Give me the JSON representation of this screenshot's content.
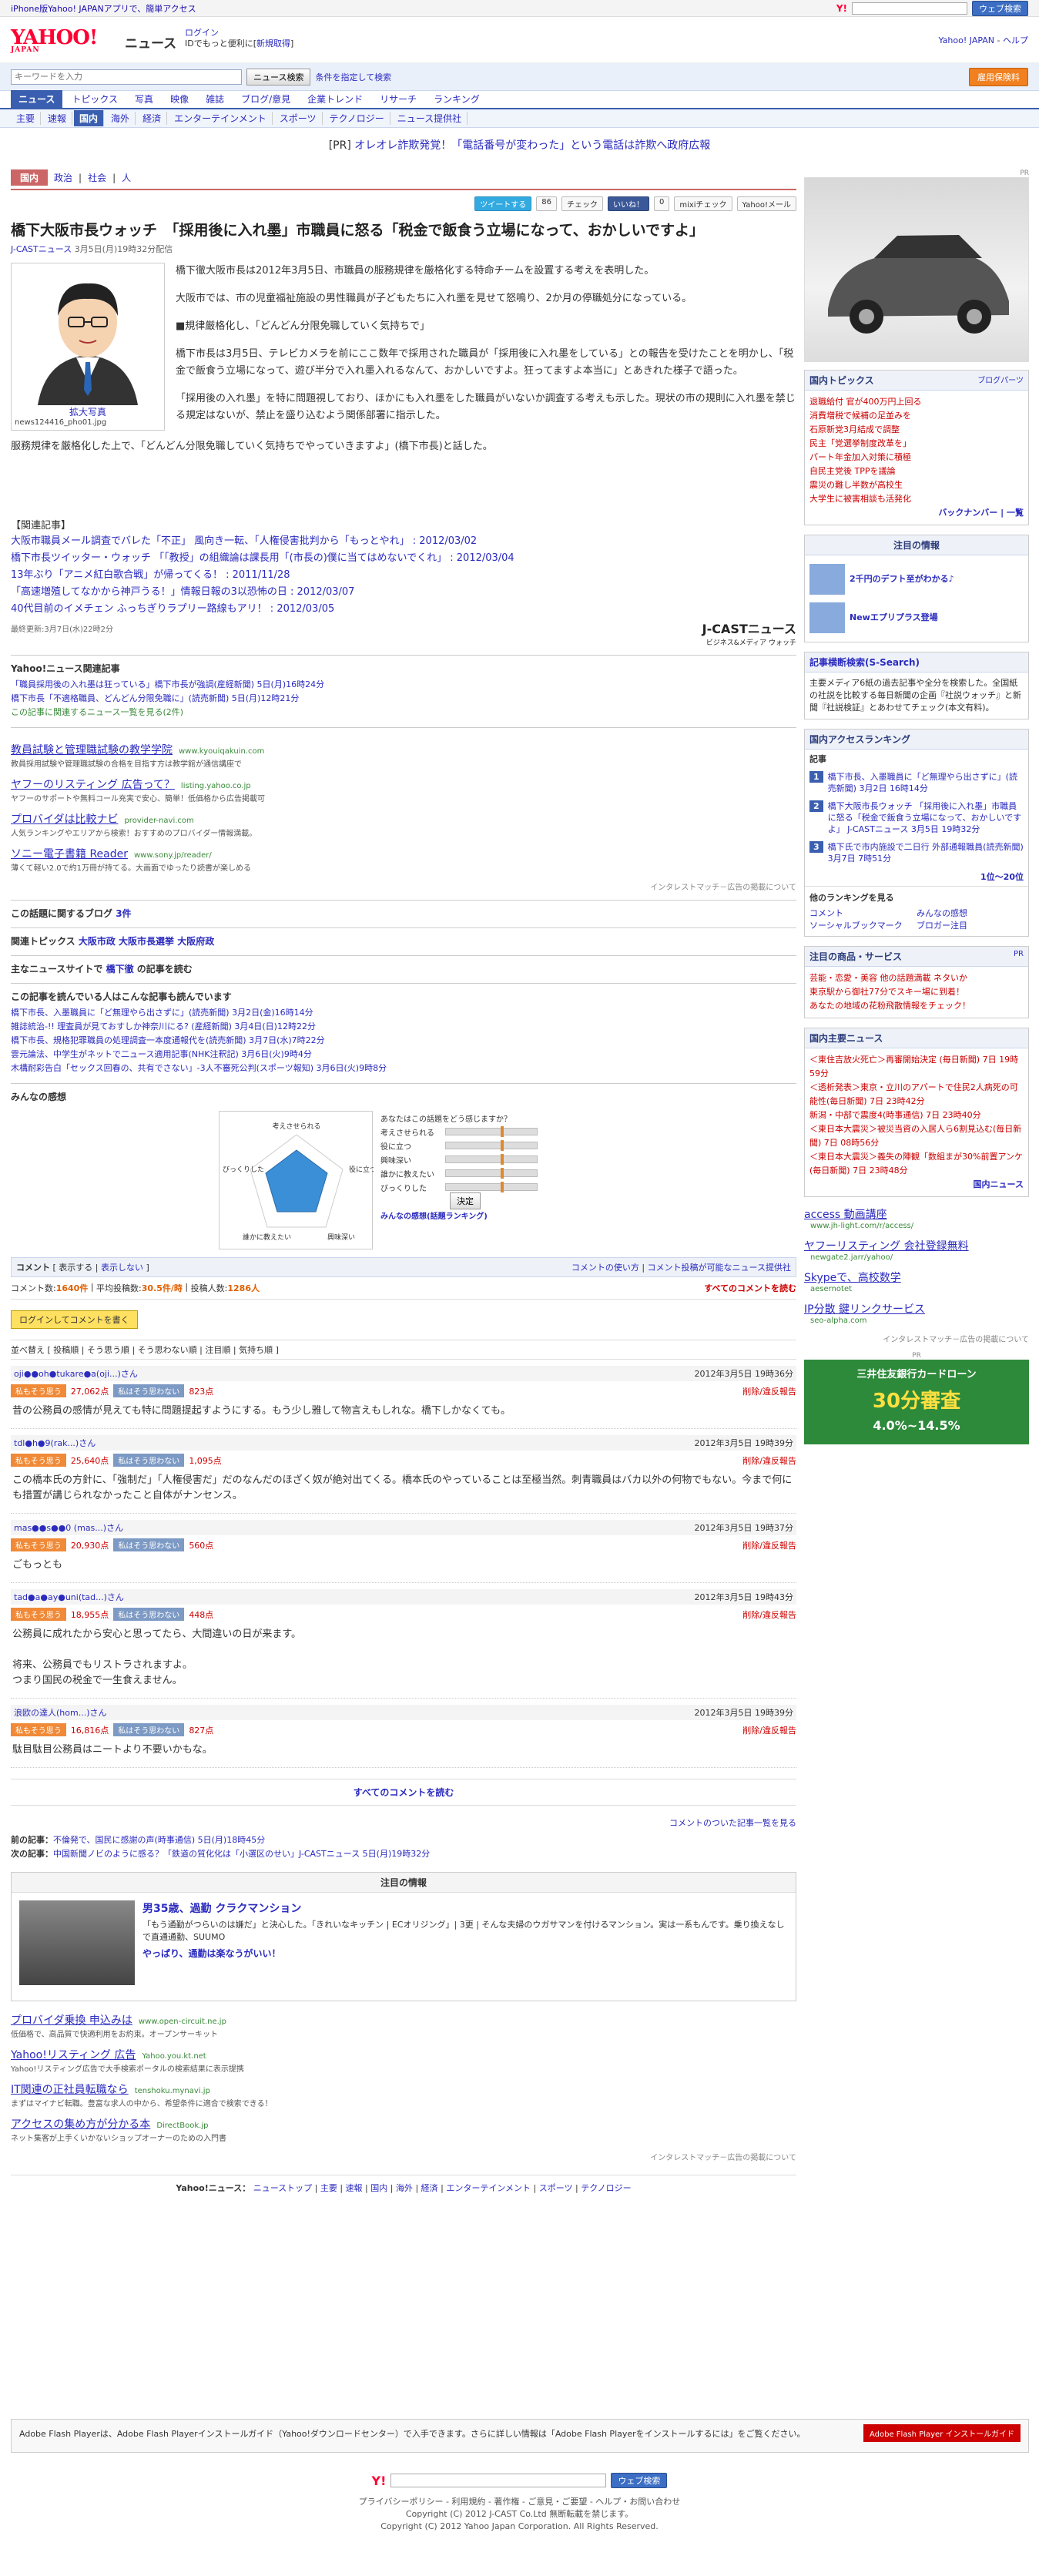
{
  "topbar": {
    "promo": "iPhone版Yahoo! JAPANアプリで、簡単アクセス",
    "search_btn": "ウェブ検索"
  },
  "header": {
    "logo": "YAHOO!",
    "logo_sub": "JAPAN",
    "section": "ニュース",
    "login": "ログイン",
    "login_sub": "IDでもっと便利に[",
    "signup": "新規取得",
    "close": "]",
    "home": "Yahoo! JAPAN",
    "help": "ヘルプ"
  },
  "search": {
    "placeholder": "キーワードを入力",
    "button": "ニュース検索",
    "cond": "条件を指定して検索",
    "orange": "雇用保険料"
  },
  "nav1": [
    "ニュース",
    "トピックス",
    "写真",
    "映像",
    "雑誌",
    "ブログ/意見",
    "企業トレンド",
    "リサーチ",
    "ランキング"
  ],
  "nav2": [
    "主要",
    "速報",
    "国内",
    "海外",
    "経済",
    "エンターテインメント",
    "スポーツ",
    "テクノロジー",
    "ニュース提供社"
  ],
  "pr": {
    "label": "[PR]",
    "text": "オレオレ詐欺発覚！「電話番号が変わった」という電話は詐欺へ政府広報"
  },
  "cats": {
    "on": "国内",
    "items": [
      "政治",
      "社会",
      "人"
    ]
  },
  "share": {
    "tweet": "ツイートする",
    "count": "86",
    "check": "チェック",
    "like": "いいね！",
    "count2": "0",
    "mixi": "mixiチェック",
    "mail": "Yahoo!メール"
  },
  "article": {
    "title": "橋下大阪市長ウォッチ　「採用後に入れ墨」市職員に怒る「税金で飯食う立場になって、おかしいですよ」",
    "source": "J-CASTニュース",
    "date": "3月5日(月)19時32分配信",
    "photo_link": "拡大写真",
    "photo_cap": "news124416_pho01.jpg",
    "p1": "橋下徹大阪市長は2012年3月5日、市職員の服務規律を厳格化する特命チームを設置する考えを表明した。",
    "p2": "大阪市では、市の児童福祉施設の男性職員が子どもたちに入れ墨を見せて怒鳴り、2か月の停職処分になっている。",
    "p3": "■規律厳格化し、「どんどん分限免職していく気持ちで」",
    "p4": "橋下市長は3月5日、テレビカメラを前にここ数年で採用された職員が「採用後に入れ墨をしている」との報告を受けたことを明かし、「税金で飯食う立場になって、遊び半分で入れ墨入れるなんて、おかしいですよ。狂ってますよ本当に」とあきれた様子で語った。",
    "p5": "「採用後の入れ墨」を特に問題視しており、ほかにも入れ墨をした職員がいないか調査する考えも示した。現状の市の規則に入れ墨を禁じる規定はないが、禁止を盛り込むよう関係部署に指示した。",
    "p6": "服務規律を厳格化した上で、「どんどん分限免職していく気持ちでやっていきますよ」(橋下市長)と話した。",
    "rel_title": "【関連記事】",
    "rel": [
      "大阪市職員メール調査でバレた「不正」 風向き一転、「人権侵害批判から「もっとやれ」 : 2012/03/02",
      "橋下市長ツイッター・ウォッチ 「「教授」の組織論は課長用「(市長の)僕に当てはめないでくれ」 : 2012/03/04",
      "13年ぶり「アニメ紅白歌合戦」が帰ってくる！ : 2011/11/28",
      "「高速増殖してなかから神戸うる！」情報日報の3以恐怖の日 : 2012/03/07",
      "40代目前のイメチェン ふっちぎりラプリー路線もアリ！ : 2012/03/05"
    ],
    "updated": "最終更新:3月7日(水)22時2分",
    "jcast": "J-CASTニュース",
    "jcast_sub": "ビジネス&メディア ウォッチ"
  },
  "related_news": {
    "title": "Yahoo!ニュース関連記事",
    "items": [
      "「職員採用後の入れ墨は狂っている」橋下市長が強調(産経新聞) 5日(月)16時24分",
      "橋下市長「不適格職員、どんどん分限免職に」(読売新聞) 5日(月)12時21分"
    ],
    "more": "この記事に関連するニュース一覧を見る(2件)"
  },
  "ads": [
    {
      "t": "教員試験と管理職試験の教学学院",
      "u": "www.kyouiqakuin.com",
      "d": "教員採用試験や管理職試験の合格を目指す方は教学館が通信講座で"
    },
    {
      "t": "ヤフーのリスティング 広告って？",
      "u": "listing.yahoo.co.jp",
      "d": "ヤフーのサポートや無料コール充実で安心、簡単！低価格から広告掲載可"
    },
    {
      "t": "プロバイダは比較ナビ",
      "u": "provider-navi.com",
      "d": "人気ランキングやエリアから検索！おすすめのプロバイダー情報満載。"
    },
    {
      "t": "ソニー電子書籍 Reader",
      "u": "www.sony.jp/reader/",
      "d": "薄くて軽い2.0で約1万冊が持てる。大画面でゆったり読書が楽しめる"
    }
  ],
  "adfoot": "インタレストマッチ－広告の掲載について",
  "blog": {
    "t": "この話題に関するブログ",
    "n": "3件"
  },
  "topics": {
    "t": "関連トピックス",
    "items": [
      "大阪市政",
      "大阪市長選挙",
      "大阪府政"
    ]
  },
  "major": {
    "t": "主なニュースサイトで",
    "k": "橋下徹",
    "r": "の記事を読む"
  },
  "readers": {
    "t": "この記事を読んでいる人はこんな記事も読んでいます",
    "items": [
      "橋下市長、入墨職員に「ど無理やら出さずに」(読売新聞) 3月2日(金)16時14分",
      "雑誌統治-!! 理査員が見ておすしか神奈川にる? (産経新聞) 3月4日(日)12時22分",
      "橋下市長、規格犯罪職員の処理調査一本度通報代を(読売新聞) 3月7日(水)7時22分",
      "雲元論法、中学生がネットで二ュース適用記事(NHK注釈記) 3月6日(火)9時4分",
      "木構耐彩告白「セックス回春の、共有でさない」-3人不審死公判(スポーツ報知) 3月6日(火)9時8分"
    ]
  },
  "feelings": {
    "t": "みんなの感想",
    "q": "あなたはこの話題をどう感じますか？",
    "labels": [
      "考えさせられる",
      "役に立つ",
      "興味深い",
      "誰かに教えたい",
      "びっくりした"
    ],
    "decide": "決定",
    "link": "みんなの感想(話題ランキング)"
  },
  "comments": {
    "header": "コメント",
    "show": "表示する",
    "hide": "表示しない",
    "usage": "コメントの使い方",
    "policy": "コメント投稿が可能なニュース提供社",
    "stat": "コメント数:",
    "count": "1640件",
    "avg": "平均投稿数:",
    "avgv": "30.5件/時",
    "posters": "投稿人数:",
    "postersv": "1286人",
    "all": "すべてのコメントを読む",
    "login": "ログインしてコメントを書く",
    "sort": "並べ替え [ 投稿順 | そう思う順 | そう思わない順 | 注目順 | 気持ち順 ]",
    "items": [
      {
        "user": "oji●●oh●tukare●a(oji...)さん",
        "date": "2012年3月5日 19時36分",
        "good": "27,062点",
        "bad": "823点",
        "body": "昔の公務員の感情が見えても特に問題提起すようにする。もう少し雅して物言えもしれな。橋下しかなくても。"
      },
      {
        "user": "tdl●h●9(rak...)さん",
        "date": "2012年3月5日 19時39分",
        "good": "25,640点",
        "bad": "1,095点",
        "body": "この橋本氏の方針に、「強制だ」「人権侵害だ」だのなんだのほざく奴が絶対出てくる。橋本氏のやっていることは至極当然。刺青職員はバカ以外の何物でもない。今まで何にも措置が講じられなかったこと自体がナンセンス。"
      },
      {
        "user": "mas●●s●●0 (mas...)さん",
        "date": "2012年3月5日 19時37分",
        "good": "20,930点",
        "bad": "560点",
        "body": "ごもっとも"
      },
      {
        "user": "tad●a●ay●uni(tad...)さん",
        "date": "2012年3月5日 19時43分",
        "good": "18,955点",
        "bad": "448点",
        "body": "公務員に成れたから安心と思ってたら、大間違いの日が来ます。\n\n将来、公務員でもリストラされますよ。\nつまり国民の税金で一生食えません。"
      },
      {
        "user": "浪欧の達人(hom...)さん",
        "date": "2012年3月5日 19時39分",
        "good": "16,816点",
        "bad": "827点",
        "body": "駄目駄目公務員はニートより不要いかもな。"
      }
    ],
    "agree": "私もそう思う",
    "disagree": "私はそう思わない",
    "report": "削除/違反報告"
  },
  "allcomments": "すべてのコメントを読む",
  "list_link": "コメントのついた記事一覧を見る",
  "prevnext": {
    "prev_label": "前の記事：",
    "prev": "不倫発で、国民に感謝の声(時事通信) 5日(月)18時45分",
    "next_label": "次の記事：",
    "next": "中国新聞ノビのように感る？「鉄道の質化化は「小選区のせい」J-CASTニュース 5日(月)19時32分"
  },
  "notice": {
    "t": "注目の情報",
    "h": "男35歳、過勤 クラクマンション",
    "d": "「もう通勤がつらいのは嫌だ」と決心した。「きれいなキッチン | ECオリジング」| 3更 | そんな夫婦のウガサマンを付けるマンション。実は一系もんです。乗り換えなしで直通通勤、SUUMO",
    "l": "やっぱり、通勤は楽なうがいい！"
  },
  "ads2": [
    {
      "t": "プロバイダ乗換 申込みは",
      "u": "www.open-circuit.ne.jp",
      "d": "低価格で、高品質で快適利用をお約束。オープンサーキット"
    },
    {
      "t": "Yahoo!リスティング 広告",
      "u": "Yahoo.you.kt.net",
      "d": "Yahoo!リスティング広告で大手検索ポータルの検索結果に表示提携"
    },
    {
      "t": "IT関連の正社員転職なら",
      "u": "tenshoku.mynavi.jp",
      "d": "まずはマイナビ転職。豊富な求人の中から、希望条件に適合で検索できる！"
    },
    {
      "t": "アクセスの集め方が分かる本",
      "u": "DirectBook.jp",
      "d": "ネット集客が上手くいかないショップオーナーのための入門書"
    }
  ],
  "fbar": {
    "label": "Yahoo!ニュース：",
    "items": [
      "ニューストップ",
      "主要",
      "速報",
      "国内",
      "海外",
      "経済",
      "エンターテインメント",
      "スポーツ",
      "テクノロジー"
    ]
  },
  "flash": {
    "text": "Adobe Flash Playerは、Adobe Flash Playerインストールガイド（Yahoo!ダウンロードセンター）で入手できます。さらに詳しい情報は「Adobe Flash Playerをインストールするには」をご覧ください。",
    "badge": "Adobe Flash Player インストールガイド"
  },
  "footer": {
    "btn": "ウェブ検索",
    "links": "プライバシーポリシー - 利用規約 - 著作権 - ご意見・ご要望 - ヘルプ・お問い合わせ",
    "copy1": "Copyright (C) 2012 J-CAST Co.Ltd 無断転載を禁じます。",
    "copy2": "Copyright (C) 2012 Yahoo Japan Corporation. All Rights Reserved."
  },
  "side": {
    "pr": "PR",
    "topics_t": "国内トピックス",
    "topics_more": "ブログパーツ",
    "topics": [
      "退職給付 官が400万円上回る",
      "消費増税で候補の足並みを",
      "石原新党3月結成で調整",
      "民主「党選挙制度改革を」",
      "パート年金加入対策に積極",
      "自民主党後 TPPを議論",
      "震災の難し半数が高校生",
      "大学生に被害相談も活発化"
    ],
    "back": "バックナンバー",
    "list": "一覧",
    "att_t": "注目の情報",
    "att": [
      "2千円のデフト至がわかる♪",
      "Newエプリプラス登場"
    ],
    "sc_t": "記事横断検索(S-Search)",
    "sc": "主要メディア6紙の過去記事や全分を検索した。全国紙の社説を比較する毎日新聞の企画『社説ウォッチ』と新聞『社説検証』とあわせてチェック(本文有料)。",
    "rank_t": "国内アクセスランキング",
    "rank_sub": "記事",
    "rank": [
      "橋下市長、入墨職員に「ど無理やら出さずに」(読売新聞) 3月2日 16時14分",
      "橋下大阪市長ウォッチ 「採用後に入れ墨」市職員に怒る「税金で飯食う立場になって、おかしいですよ」 J-CASTニュース 3月5日 19時32分",
      "橋下氏で市内施設で二日行 外部通報職員(読売新聞) 3月7日 7時51分"
    ],
    "page": "1位〜20位",
    "more_t": "他のランキングを見る",
    "more": [
      "コメント",
      "ソーシャルブックマーク",
      "みんなの感想",
      "ブロガー注目"
    ],
    "goods_t": "注目の商品・サービス",
    "goods": [
      "芸能・恋愛・美容 他の話題満載 ネタいか",
      "東京駅から御社77分でスキー場に到着！",
      "あなたの地域の花粉飛散情報をチェック！"
    ],
    "main_t": "国内主要ニュース",
    "main": [
      "＜東住吉放火死亡＞再審開始決定 (毎日新聞) 7日 19時59分",
      "＜透析発表＞東京・立川のアパートで住民2人病死の可能性(毎日新聞) 7日 23時42分",
      "新潟・中部で震度4(時事通信) 7日 23時40分",
      "＜東日本大震災＞被災当資の入居人ら6割見込む(毎日新聞) 7日 08時56分",
      "＜東日本大震災＞義失の陣観「数組まが30%前置アンケ(毎日新聞) 7日 23時48分"
    ],
    "main_more": "国内ニュース",
    "ads": [
      {
        "t": "access 動画講座",
        "u": "www.jh-light.com/r/access/"
      },
      {
        "t": "ヤフーリスティング 会社登録無料",
        "u": "newgate2.jarr/yahoo/"
      },
      {
        "t": "Skypeで、高校数学",
        "u": "aesernotet"
      },
      {
        "t": "IP分散 鍵リンクサービス",
        "u": "seo-alpha.com"
      }
    ],
    "bank": "三井住友銀行カードローン",
    "bank2": "30分審査",
    "bank3": "4.0%~14.5%"
  }
}
